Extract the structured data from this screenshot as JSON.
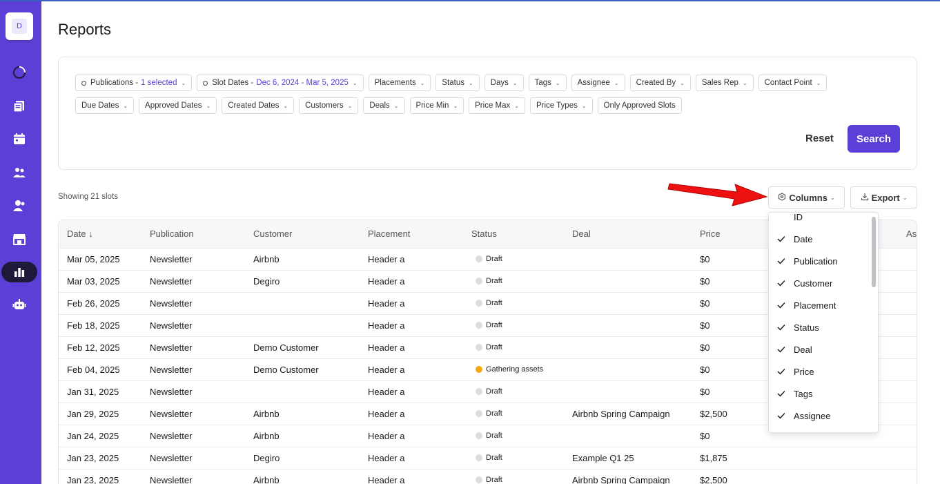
{
  "sidebar": {
    "logo_letter": "D",
    "icons": [
      "circle-progress-icon",
      "publications-icon",
      "calendar-icon",
      "customers-icon",
      "team-icon",
      "storefront-icon",
      "reports-icon",
      "bot-icon"
    ],
    "active": "reports-icon"
  },
  "page": {
    "title": "Reports"
  },
  "filters": {
    "row1": [
      {
        "label": "Publications - ",
        "selected": "1 selected",
        "has_dot": true
      },
      {
        "label": "Slot Dates - ",
        "selected": "Dec 6, 2024 - Mar 5, 2025",
        "has_dot": true
      },
      {
        "label": "Placements"
      },
      {
        "label": "Status"
      },
      {
        "label": "Days"
      },
      {
        "label": "Tags"
      },
      {
        "label": "Assignee"
      },
      {
        "label": "Created By"
      },
      {
        "label": "Sales Rep"
      },
      {
        "label": "Contact Point"
      }
    ],
    "row2": [
      {
        "label": "Due Dates"
      },
      {
        "label": "Approved Dates"
      },
      {
        "label": "Created Dates"
      },
      {
        "label": "Customers"
      },
      {
        "label": "Deals"
      },
      {
        "label": "Price Min"
      },
      {
        "label": "Price Max"
      },
      {
        "label": "Price Types"
      },
      {
        "label": "Only Approved Slots",
        "no_chevron": true
      }
    ],
    "reset_label": "Reset",
    "search_label": "Search"
  },
  "toolbar": {
    "showing": "Showing 21 slots",
    "columns_label": "Columns",
    "export_label": "Export"
  },
  "table": {
    "headers": [
      "Date",
      "Publication",
      "Customer",
      "Placement",
      "Status",
      "Deal",
      "Price",
      "As"
    ],
    "rows": [
      [
        "Mar 05, 2025",
        "Newsletter",
        "Airbnb",
        "Header a",
        "Draft",
        "",
        "$0"
      ],
      [
        "Mar 03, 2025",
        "Newsletter",
        "Degiro",
        "Header a",
        "Draft",
        "",
        "$0"
      ],
      [
        "Feb 26, 2025",
        "Newsletter",
        "",
        "Header a",
        "Draft",
        "",
        "$0"
      ],
      [
        "Feb 18, 2025",
        "Newsletter",
        "",
        "Header a",
        "Draft",
        "",
        "$0"
      ],
      [
        "Feb 12, 2025",
        "Newsletter",
        "Demo Customer",
        "Header a",
        "Draft",
        "",
        "$0"
      ],
      [
        "Feb 04, 2025",
        "Newsletter",
        "Demo Customer",
        "Header a",
        "Gathering assets",
        "",
        "$0"
      ],
      [
        "Jan 31, 2025",
        "Newsletter",
        "",
        "Header a",
        "Draft",
        "",
        "$0"
      ],
      [
        "Jan 29, 2025",
        "Newsletter",
        "Airbnb",
        "Header a",
        "Draft",
        "Airbnb Spring Campaign",
        "$2,500"
      ],
      [
        "Jan 24, 2025",
        "Newsletter",
        "Airbnb",
        "Header a",
        "Draft",
        "",
        "$0"
      ],
      [
        "Jan 23, 2025",
        "Newsletter",
        "Degiro",
        "Header a",
        "Draft",
        "Example Q1 25",
        "$1,875"
      ],
      [
        "Jan 23, 2025",
        "Newsletter",
        "Airbnb",
        "Header a",
        "Draft",
        "Airbnb Spring Campaign",
        "$2,500"
      ]
    ],
    "status_colors": {
      "Draft": "#dcdcdc",
      "Gathering assets": "#f4a90c"
    }
  },
  "columns_dropdown": {
    "items": [
      {
        "label": "ID",
        "checked": false
      },
      {
        "label": "Date",
        "checked": true
      },
      {
        "label": "Publication",
        "checked": true
      },
      {
        "label": "Customer",
        "checked": true
      },
      {
        "label": "Placement",
        "checked": true
      },
      {
        "label": "Status",
        "checked": true
      },
      {
        "label": "Deal",
        "checked": true
      },
      {
        "label": "Price",
        "checked": true
      },
      {
        "label": "Tags",
        "checked": true
      },
      {
        "label": "Assignee",
        "checked": true
      }
    ]
  },
  "colors": {
    "brand": "#5b3fd6",
    "sidebar_active": "#1e1b3a",
    "arrow": "#ee1111"
  }
}
